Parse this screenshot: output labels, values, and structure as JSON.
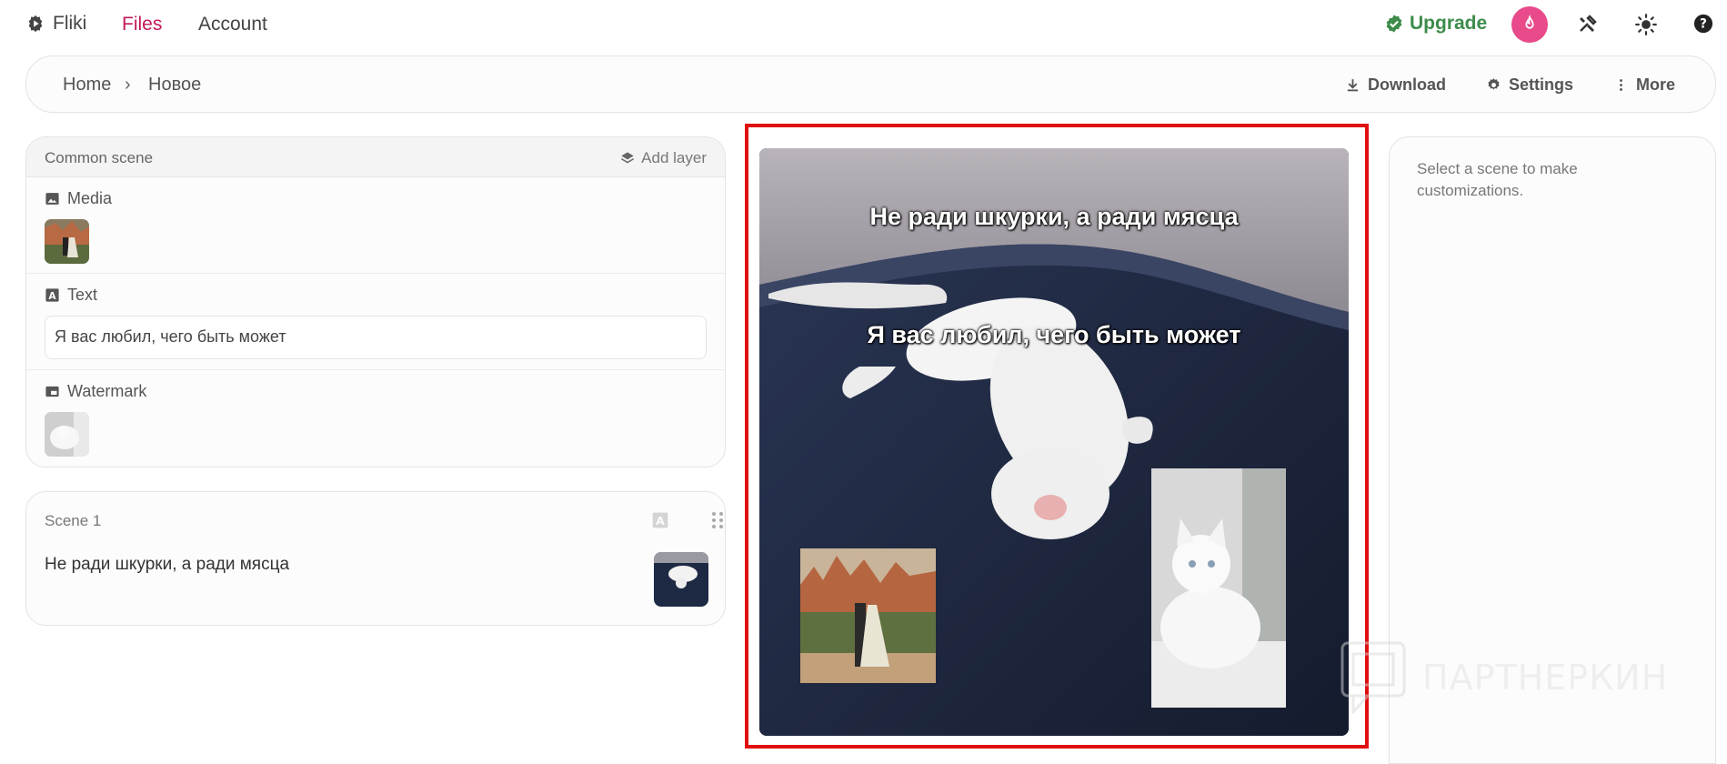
{
  "nav": {
    "brand": "Fliki",
    "files": "Files",
    "account": "Account",
    "upgrade": "Upgrade"
  },
  "breadcrumb": {
    "home": "Home",
    "separator": "›",
    "current": "Новое"
  },
  "actions": {
    "download": "Download",
    "settings": "Settings",
    "more": "More"
  },
  "common_scene": {
    "title": "Common scene",
    "add_layer": "Add layer",
    "media_label": "Media",
    "text_label": "Text",
    "text_value": "Я вас любил, чего быть может",
    "watermark_label": "Watermark"
  },
  "scene": {
    "title": "Scene 1",
    "text": "Не ради шкурки, а ради мясца"
  },
  "preview": {
    "line1": "Не ради шкурки, а ради мясца",
    "line2": "Я вас любил, чего быть может"
  },
  "right_panel": {
    "hint": "Select a scene to make customizations."
  },
  "watermark_logo": "ПАРТНЕРКИН",
  "colors": {
    "accent": "#c2185b",
    "upgrade": "#3d8c4a",
    "avatar": "#e84a8a",
    "highlight_border": "#e01010"
  }
}
